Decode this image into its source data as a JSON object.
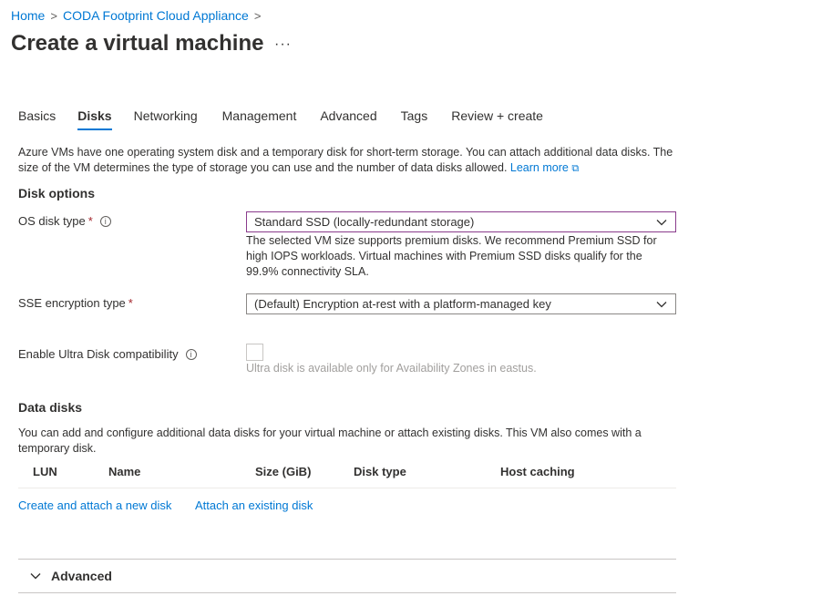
{
  "breadcrumb": {
    "home": "Home",
    "appliance": "CODA Footprint Cloud Appliance",
    "separator": ">"
  },
  "page": {
    "title": "Create a virtual machine",
    "more": "···"
  },
  "tabs": [
    {
      "label": "Basics",
      "active": false
    },
    {
      "label": "Disks",
      "active": true
    },
    {
      "label": "Networking",
      "active": false
    },
    {
      "label": "Management",
      "active": false
    },
    {
      "label": "Advanced",
      "active": false
    },
    {
      "label": "Tags",
      "active": false
    },
    {
      "label": "Review + create",
      "active": false
    }
  ],
  "intro": {
    "text": "Azure VMs have one operating system disk and a temporary disk for short-term storage. You can attach additional data disks. The size of the VM determines the type of storage you can use and the number of data disks allowed.",
    "learn_more": "Learn more"
  },
  "disk_options": {
    "title": "Disk options",
    "os_disk_type": {
      "label": "OS disk type",
      "required": "*",
      "value": "Standard SSD (locally-redundant storage)",
      "hint": "The selected VM size supports premium disks. We recommend Premium SSD for high IOPS workloads. Virtual machines with Premium SSD disks qualify for the 99.9% connectivity SLA."
    },
    "sse_encryption": {
      "label": "SSE encryption type",
      "required": "*",
      "value": "(Default) Encryption at-rest with a platform-managed key"
    },
    "ultra_disk": {
      "label": "Enable Ultra Disk compatibility",
      "checked": false,
      "hint": "Ultra disk is available only for Availability Zones in eastus."
    }
  },
  "data_disks": {
    "title": "Data disks",
    "description": "You can add and configure additional data disks for your virtual machine or attach existing disks. This VM also comes with a temporary disk.",
    "columns": [
      "LUN",
      "Name",
      "Size (GiB)",
      "Disk type",
      "Host caching"
    ],
    "create_link": "Create and attach a new disk",
    "attach_link": "Attach an existing disk"
  },
  "advanced_section": {
    "label": "Advanced"
  },
  "colors": {
    "link": "#0078d4",
    "required": "#a4262c",
    "focus_border": "#8a3b8c"
  }
}
